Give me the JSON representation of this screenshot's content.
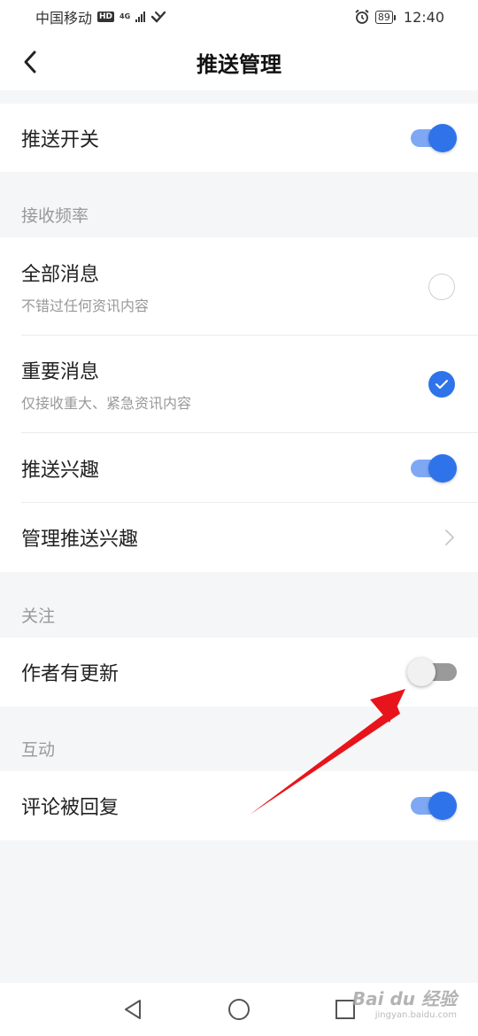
{
  "status_bar": {
    "carrier": "中国移动",
    "hd_badge": "HD",
    "network": "4G",
    "battery": "89",
    "time": "12:40"
  },
  "header": {
    "title": "推送管理"
  },
  "rows": {
    "push_switch": {
      "label": "推送开关",
      "enabled": true
    },
    "all_messages": {
      "label": "全部消息",
      "sub": "不错过任何资讯内容",
      "selected": false
    },
    "important_messages": {
      "label": "重要消息",
      "sub": "仅接收重大、紧急资讯内容",
      "selected": true
    },
    "push_interest": {
      "label": "推送兴趣",
      "enabled": true
    },
    "manage_interest": {
      "label": "管理推送兴趣"
    },
    "author_update": {
      "label": "作者有更新",
      "enabled": false
    },
    "comment_reply": {
      "label": "评论被回复",
      "enabled": true
    }
  },
  "sections": {
    "frequency": "接收频率",
    "follow": "关注",
    "interaction": "互动"
  },
  "watermark": {
    "brand": "Bai du 经验",
    "url": "jingyan.baidu.com"
  },
  "colors": {
    "accent": "#2e73ea",
    "accent_track": "#7ea8f4",
    "annotation_arrow": "#e8141b",
    "background": "#f5f6f8"
  }
}
